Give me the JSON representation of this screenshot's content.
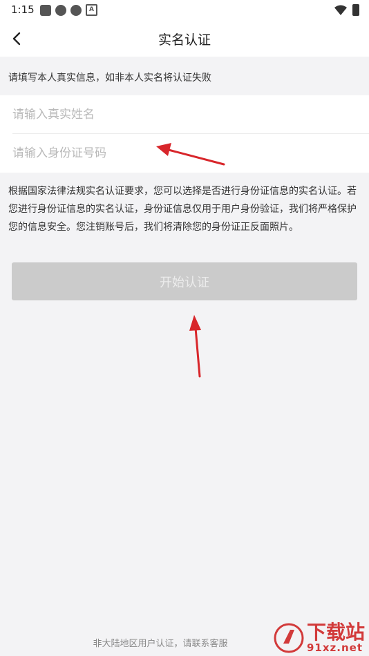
{
  "statusbar": {
    "time": "1:15",
    "a_icon": "A"
  },
  "navbar": {
    "title": "实名认证",
    "back_icon": "chevron-left-icon"
  },
  "form": {
    "hint": "请填写本人真实信息，如非本人实名将认证失败",
    "name_placeholder": "请输入真实姓名",
    "id_placeholder": "请输入身份证号码"
  },
  "notice": "根据国家法律法规实名认证要求，您可以选择是否进行身份证信息的实名认证。若您进行身份证信息的实名认证，身份证信息仅用于用户身份验证，我们将严格保护您的信息安全。您注销账号后，我们将清除您的身份证正反面照片。",
  "actions": {
    "start_label": "开始认证"
  },
  "footer": {
    "text": "非大陆地区用户认证，请联系客服"
  },
  "watermark": {
    "title": "下载站",
    "url": "91xz.net"
  },
  "colors": {
    "button_disabled": "#cbcbcb",
    "annotation_arrow": "#d8262b",
    "watermark": "#d23a3a"
  }
}
